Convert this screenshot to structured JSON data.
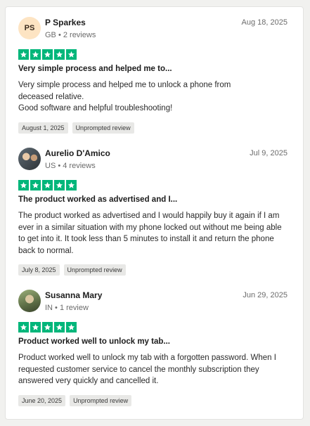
{
  "reviews": [
    {
      "avatar_initials": "PS",
      "name": "P Sparkes",
      "meta": "GB • 2 reviews",
      "date": "Aug 18, 2025",
      "rating": 5,
      "title": "Very simple process and helped me to...",
      "body": "Very simple process and helped me to unlock a phone from deceased relative.\nGood software and helpful troubleshooting!",
      "experience_date": "August 1, 2025",
      "tag": "Unprompted review"
    },
    {
      "name": "Aurelio D'Amico",
      "meta": "US • 4 reviews",
      "date": "Jul 9, 2025",
      "rating": 5,
      "title": "The product worked as advertised and I...",
      "body": "The product worked as advertised and I would happily buy it again if I am ever in a similar situation with my phone locked out without me being able to get into it. It took less than 5 minutes to install it and return the phone back to normal.",
      "experience_date": "July 8, 2025",
      "tag": "Unprompted review"
    },
    {
      "name": "Susanna Mary",
      "meta": "IN • 1 review",
      "date": "Jun 29, 2025",
      "rating": 5,
      "title": "Product worked well to unlock my tab...",
      "body": "Product worked well to unlock my tab with a forgotten password. When I requested customer service to cancel the monthly subscription they answered very quickly and cancelled it.",
      "experience_date": "June 20, 2025",
      "tag": "Unprompted review"
    }
  ],
  "icons": {
    "star": "star-icon"
  },
  "colors": {
    "star_bg": "#00b67a",
    "avatar_initials_bg": "#fde4c3"
  }
}
